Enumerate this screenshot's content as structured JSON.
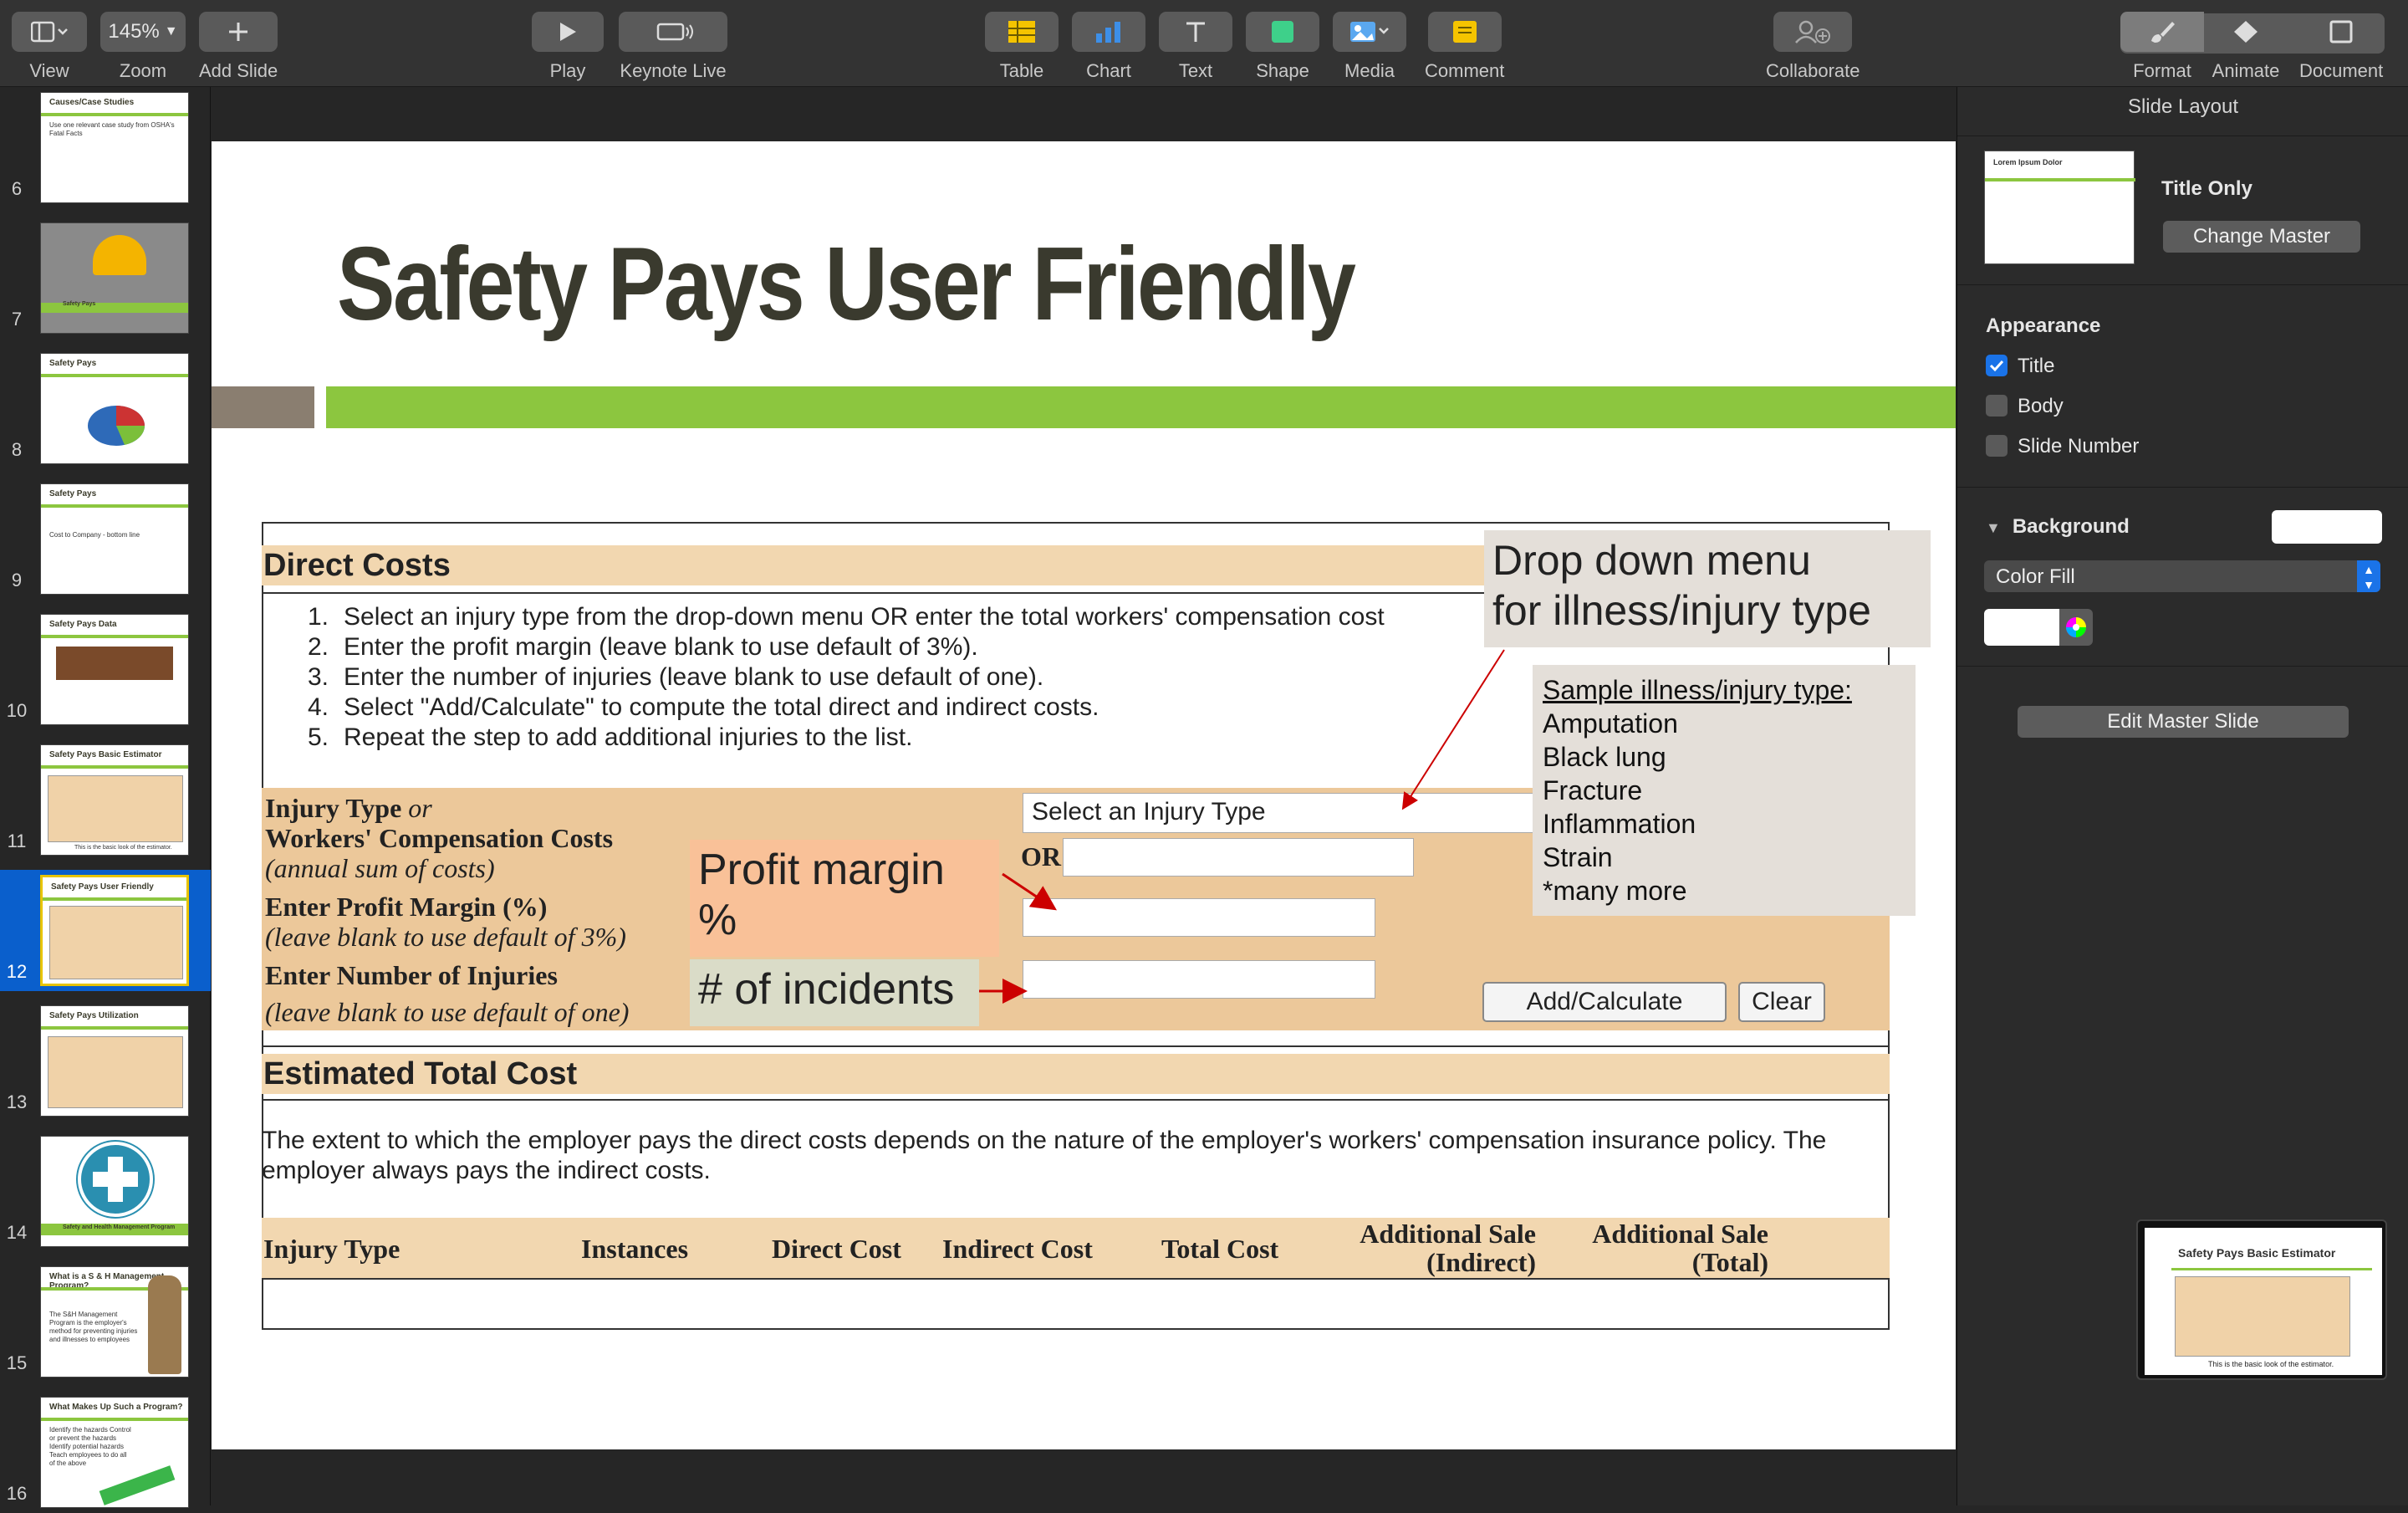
{
  "toolbar": {
    "view": "View",
    "zoom_value": "145%",
    "zoom": "Zoom",
    "add_slide": "Add Slide",
    "play": "Play",
    "keynote_live": "Keynote Live",
    "table": "Table",
    "chart": "Chart",
    "text": "Text",
    "shape": "Shape",
    "media": "Media",
    "comment": "Comment",
    "collaborate": "Collaborate",
    "format": "Format",
    "animate": "Animate",
    "document": "Document"
  },
  "slides": [
    {
      "num": "6",
      "title": "Causes/Case Studies",
      "body": "Use one relevant case study from OSHA's Fatal Facts"
    },
    {
      "num": "7",
      "title": "",
      "body": "Safety Pays"
    },
    {
      "num": "8",
      "title": "Safety Pays",
      "body": ""
    },
    {
      "num": "9",
      "title": "Safety Pays",
      "body": "Cost to Company - bottom line"
    },
    {
      "num": "10",
      "title": "Safety Pays Data",
      "body": ""
    },
    {
      "num": "11",
      "title": "Safety Pays Basic Estimator",
      "body": "This is the basic look of the estimator."
    },
    {
      "num": "12",
      "title": "Safety Pays User Friendly",
      "body": ""
    },
    {
      "num": "13",
      "title": "Safety Pays Utilization",
      "body": ""
    },
    {
      "num": "14",
      "title": "",
      "body": "Safety and Health Management Program"
    },
    {
      "num": "15",
      "title": "What is a S & H Management Program?",
      "body": "The S&H Management Program is the employer's method for preventing injuries and illnesses to employees"
    },
    {
      "num": "16",
      "title": "What Makes Up Such a Program?",
      "body": "Identify the hazards Control or prevent the hazards Identify potential hazards Teach employees to do all of the above"
    }
  ],
  "slide": {
    "title": "Safety Pays User Friendly",
    "direct_costs": "Direct Costs",
    "instructions": [
      {
        "n": "1.",
        "t": "Select an injury type from the drop-down menu OR enter the total workers' compensation cost"
      },
      {
        "n": "2.",
        "t": "Enter the profit margin (leave blank to use default of 3%)."
      },
      {
        "n": "3.",
        "t": "Enter the number of injuries (leave blank to use default of one)."
      },
      {
        "n": "4.",
        "t": "Select \"Add/Calculate\" to compute the total direct and indirect costs."
      },
      {
        "n": "5.",
        "t": "Repeat the step to add additional injuries to the list."
      }
    ],
    "injury_type_label": "Injury Type",
    "or_italic": "or",
    "wc_costs_label": "Workers' Compensation Costs",
    "annual_sum": "(annual sum of costs)",
    "profit_margin_label": "Enter Profit Margin (%)",
    "profit_hint": "(leave blank to use default of 3%)",
    "injuries_label": "Enter Number of Injuries",
    "injuries_hint": "(leave blank to use default of one)",
    "select_placeholder": "Select an Injury Type",
    "or_label": "OR",
    "add_calculate": "Add/Calculate",
    "clear": "Clear",
    "estimated_total": "Estimated Total Cost",
    "estimate_text": "The extent to which the employer pays the direct costs depends on the nature of the employer's workers' compensation insurance policy. The employer always pays the indirect costs.",
    "columns": {
      "injury_type": "Injury Type",
      "instances": "Instances",
      "direct_cost": "Direct Cost",
      "indirect_cost": "Indirect Cost",
      "total_cost": "Total Cost",
      "add_sale_indirect_1": "Additional Sale",
      "add_sale_indirect_2": "(Indirect)",
      "add_sale_total_1": "Additional Sale",
      "add_sale_total_2": "(Total)"
    },
    "callout_dropdown_1": "Drop down menu",
    "callout_dropdown_2": "for illness/injury type",
    "callout_profit_1": "Profit margin",
    "callout_profit_2": "%",
    "callout_incidents": "# of incidents",
    "sample_title": "Sample illness/injury type:",
    "samples": [
      "Amputation",
      "Black lung",
      "Fracture",
      "Inflammation",
      "Strain",
      "*many more"
    ]
  },
  "panel": {
    "title": "Slide Layout",
    "thumb_text": "Lorem Ipsum Dolor",
    "layout_name": "Title Only",
    "change_master": "Change Master",
    "appearance": "Appearance",
    "title_cb": "Title",
    "body_cb": "Body",
    "slide_number_cb": "Slide Number",
    "background": "Background",
    "fill_type": "Color Fill",
    "edit_master": "Edit Master Slide",
    "preview_title": "Safety Pays Basic Estimator",
    "preview_caption": "This is the basic look of the estimator."
  },
  "colors": {
    "accent_green": "#8cc63f",
    "header_tan": "#f2d7b0",
    "input_tan": "#ecc89a",
    "selection_blue": "#0a5fcc"
  }
}
